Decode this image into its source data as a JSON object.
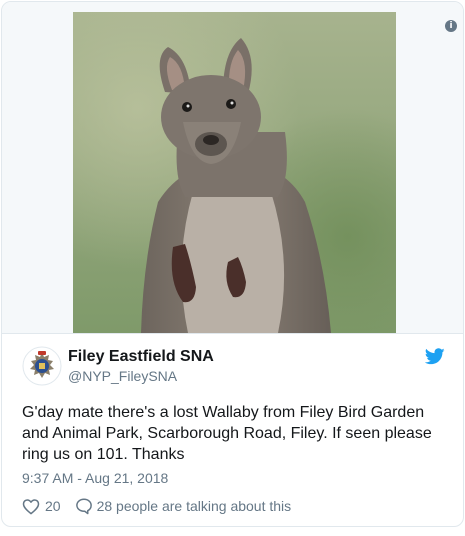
{
  "tweet": {
    "info_icon": "info-icon",
    "photo_subject": "kangaroo-photo",
    "author_name": "Filey Eastfield SNA",
    "author_handle": "@NYP_FileySNA",
    "avatar_icon": "police-badge-icon",
    "platform_icon": "twitter-bird-icon",
    "text": "G'day mate there's a lost Wallaby from Filey Bird Garden and Animal Park, Scarborough Road, Filey. If seen please ring us on 101. Thanks",
    "timestamp": "9:37 AM - Aug 21, 2018",
    "like_count": "20",
    "talking_text": "28 people are talking about this"
  },
  "colors": {
    "twitter_blue": "#1da1f2",
    "secondary_text": "#657786",
    "border": "#e1e8ed"
  }
}
